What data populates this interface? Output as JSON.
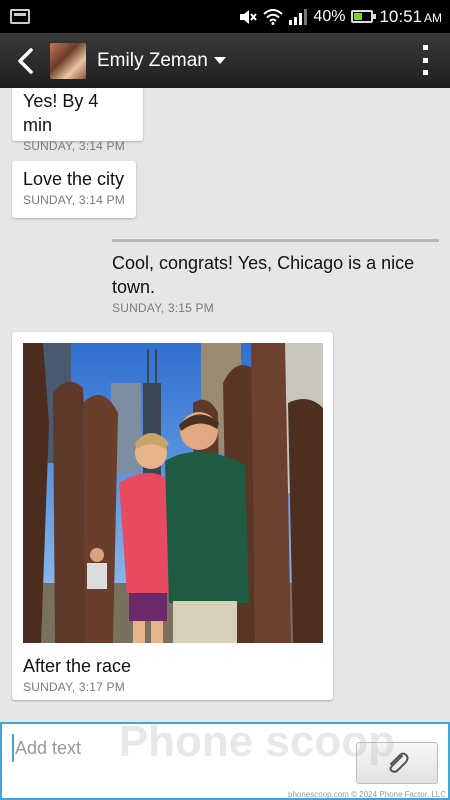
{
  "status_bar": {
    "battery": "40%",
    "battery_level": 0.4,
    "time": "10:51",
    "ampm": "AM",
    "icons": [
      "notification-icon",
      "mute-icon",
      "wifi-icon",
      "signal-icon",
      "battery-icon"
    ]
  },
  "header": {
    "contact_name": "Emily Zeman",
    "icons": [
      "back-icon",
      "avatar",
      "dropdown-caret-icon",
      "overflow-menu-icon"
    ]
  },
  "messages": [
    {
      "direction": "incoming",
      "text": "Yes! By 4 min",
      "time": "SUNDAY, 3:14 PM"
    },
    {
      "direction": "incoming",
      "text": "Love the city",
      "time": "SUNDAY, 3:14 PM"
    },
    {
      "direction": "outgoing",
      "text": "Cool, congrats! Yes, Chicago is a nice town.",
      "time": "SUNDAY, 3:15 PM"
    },
    {
      "direction": "incoming",
      "type": "photo",
      "text": "After the race",
      "time": "SUNDAY, 3:17 PM"
    }
  ],
  "composer": {
    "placeholder": "Add text",
    "attach_icon": "paperclip-icon"
  },
  "watermark": {
    "brand": "Phone scoop",
    "footer": "phonescoop.com © 2024 Phone Factor, LLC"
  },
  "colors": {
    "accent": "#3ea6d8",
    "background": "#e6e6e6",
    "bubble": "#ffffff",
    "header": "#2a2a2a"
  }
}
